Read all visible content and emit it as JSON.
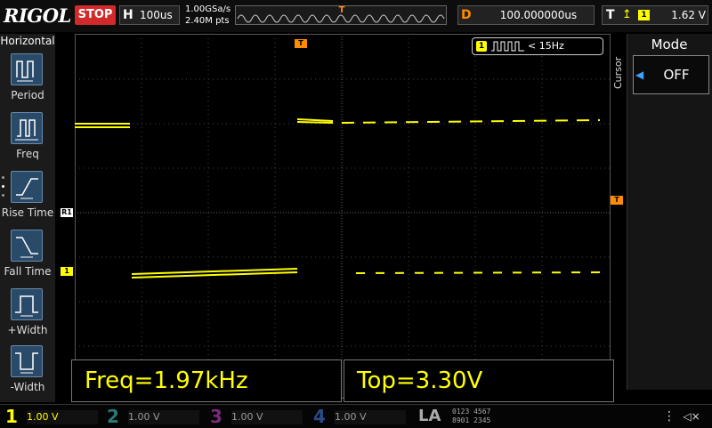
{
  "top": {
    "logo": "RIGOL",
    "run_state": "STOP",
    "timebase_letter": "H",
    "timebase": "100us",
    "sample_rate": "1.00GSa/s",
    "mem_depth": "2.40M pts",
    "delay_letter": "D",
    "delay": "100.000000us",
    "trig_letter": "T",
    "trig_source": "1",
    "trig_level": "1.62 V",
    "trig_marker": "T"
  },
  "left_menu": {
    "title": "Horizontal",
    "items": [
      {
        "label": "Period",
        "icon": "period-icon"
      },
      {
        "label": "Freq",
        "icon": "freq-icon"
      },
      {
        "label": "Rise Time",
        "icon": "rise-time-icon"
      },
      {
        "label": "Fall Time",
        "icon": "fall-time-icon"
      },
      {
        "label": "+Width",
        "icon": "plus-width-icon"
      },
      {
        "label": "-Width",
        "icon": "minus-width-icon"
      }
    ]
  },
  "waveform": {
    "counter_label": "1",
    "counter_text": "< 15Hz",
    "ch1_marker": "1",
    "ref_marker": "R1",
    "trig_level_marker": "T",
    "trace_color": "#ffff00"
  },
  "measurements": [
    {
      "text": "Freq=1.97kHz"
    },
    {
      "text": "Top=3.30V"
    }
  ],
  "cursor": {
    "side_label": "Cursor",
    "mode_title": "Mode",
    "mode_value": "OFF"
  },
  "channels": [
    {
      "num": "1",
      "scale": "1.00 V",
      "color": "#ffff00"
    },
    {
      "num": "2",
      "scale": "1.00 V",
      "color": "#00c0c0"
    },
    {
      "num": "3",
      "scale": "1.00 V",
      "color": "#e040e0"
    },
    {
      "num": "4",
      "scale": "1.00 V",
      "color": "#3070ff"
    }
  ],
  "bottom": {
    "la_label": "LA",
    "digital_row1": "0123 4567",
    "digital_row2": "8901 2345"
  }
}
